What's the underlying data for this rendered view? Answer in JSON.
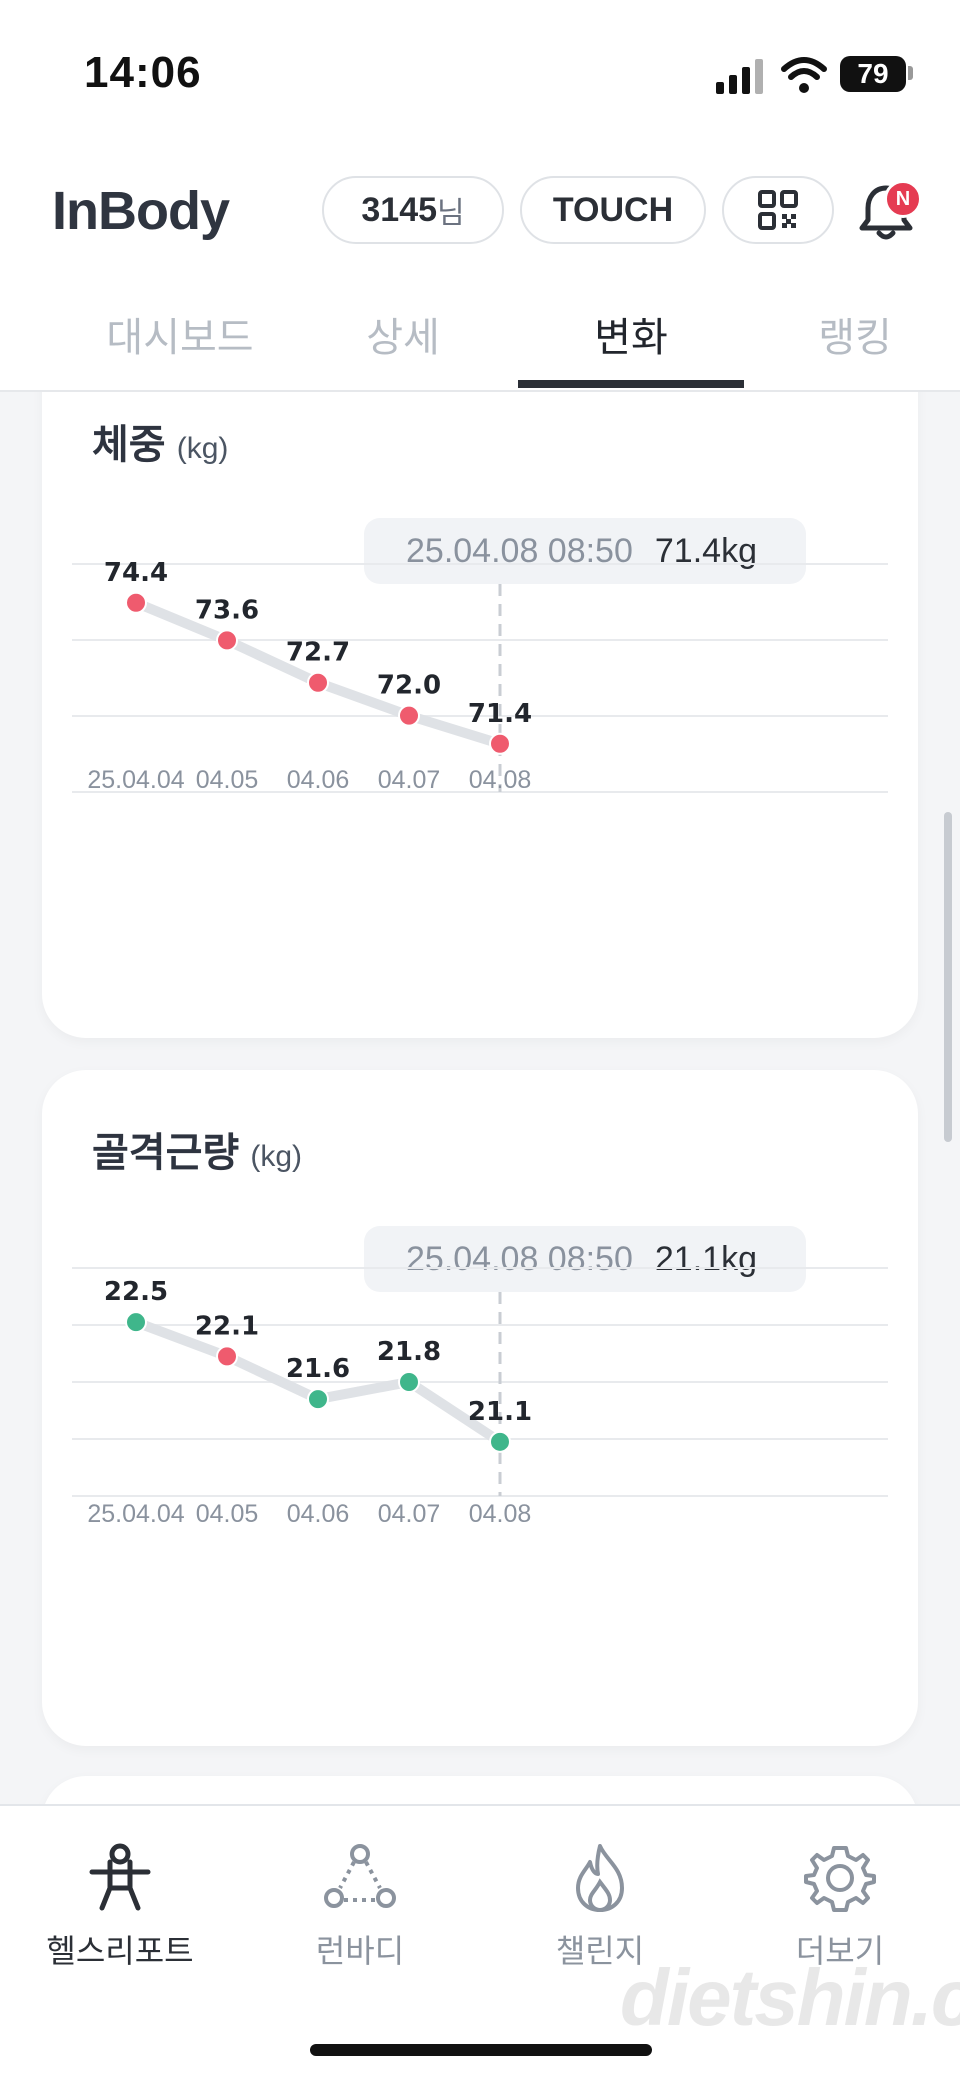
{
  "status_bar": {
    "time": "14:06",
    "battery": "79"
  },
  "header": {
    "logo": "InBody",
    "user_number": "3145",
    "user_suffix": "님",
    "touch_label": "TOUCH",
    "notification_badge": "N",
    "tabs": [
      {
        "label": "대시보드",
        "active": false
      },
      {
        "label": "상세",
        "active": false
      },
      {
        "label": "변화",
        "active": true
      },
      {
        "label": "랭킹",
        "active": false
      }
    ]
  },
  "cards": [
    {
      "title": "체중",
      "unit": "(kg)",
      "tooltip_time": "25.04.08 08:50",
      "tooltip_value": "71.4kg"
    },
    {
      "title": "골격근량",
      "unit": "(kg)",
      "tooltip_time": "25.04.08 08:50",
      "tooltip_value": "21.1kg"
    }
  ],
  "chart_data": [
    {
      "type": "line",
      "title": "체중 (kg)",
      "x": [
        "25.04.04",
        "04.05",
        "04.06",
        "04.07",
        "04.08"
      ],
      "series": [
        {
          "values": [
            74.4,
            73.6,
            72.7,
            72.0,
            71.4
          ],
          "point_colors": [
            "#ef5b6e",
            "#ef5b6e",
            "#ef5b6e",
            "#ef5b6e",
            "#ef5b6e"
          ]
        }
      ],
      "data_labels": [
        "74.4",
        "73.6",
        "72.7",
        "72.0",
        "71.4"
      ],
      "highlight_index": 4,
      "line_color": "#dfe2e6",
      "grid": true
    },
    {
      "type": "line",
      "title": "골격근량 (kg)",
      "x": [
        "25.04.04",
        "04.05",
        "04.06",
        "04.07",
        "04.08"
      ],
      "series": [
        {
          "values": [
            22.5,
            22.1,
            21.6,
            21.8,
            21.1
          ],
          "point_colors": [
            "#3fb68b",
            "#ef5b6e",
            "#3fb68b",
            "#3fb68b",
            "#3fb68b"
          ]
        }
      ],
      "data_labels": [
        "22.5",
        "22.1",
        "21.6",
        "21.8",
        "21.1"
      ],
      "highlight_index": 4,
      "line_color": "#dfe2e6",
      "grid": true
    }
  ],
  "bottom_nav": [
    {
      "label": "헬스리포트",
      "icon": "health-report-icon",
      "active": true
    },
    {
      "label": "런바디",
      "icon": "runbody-icon",
      "active": false
    },
    {
      "label": "챌린지",
      "icon": "flame-icon",
      "active": false
    },
    {
      "label": "더보기",
      "icon": "gear-icon",
      "active": false
    }
  ],
  "watermark": "dietshin.com",
  "colors": {
    "accent_red": "#ef5b6e",
    "accent_green": "#3fb68b",
    "text_dark": "#2b2f36"
  }
}
